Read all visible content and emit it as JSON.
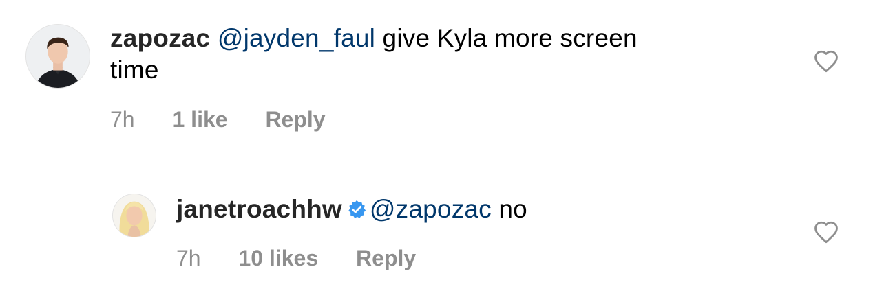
{
  "comments": [
    {
      "username": "zapozac",
      "mention": "@jayden_faul",
      "text_line1": " give Kyla more screen",
      "text_line2": "time",
      "time": "7h",
      "likes": "1 like",
      "reply": "Reply",
      "avatar_icon": "profile-photo-man",
      "heart_icon": "heart-outline-icon"
    },
    {
      "username": "janetroachhw",
      "verified_icon": "verified-badge-icon",
      "mention": "@zapozac",
      "text": " no",
      "time": "7h",
      "likes": "10 likes",
      "reply": "Reply",
      "avatar_icon": "profile-photo-woman",
      "heart_icon": "heart-outline-icon"
    }
  ],
  "colors": {
    "username": "#262626",
    "mention": "#00376b",
    "meta": "#8e8e8e",
    "verified": "#3897f0"
  }
}
